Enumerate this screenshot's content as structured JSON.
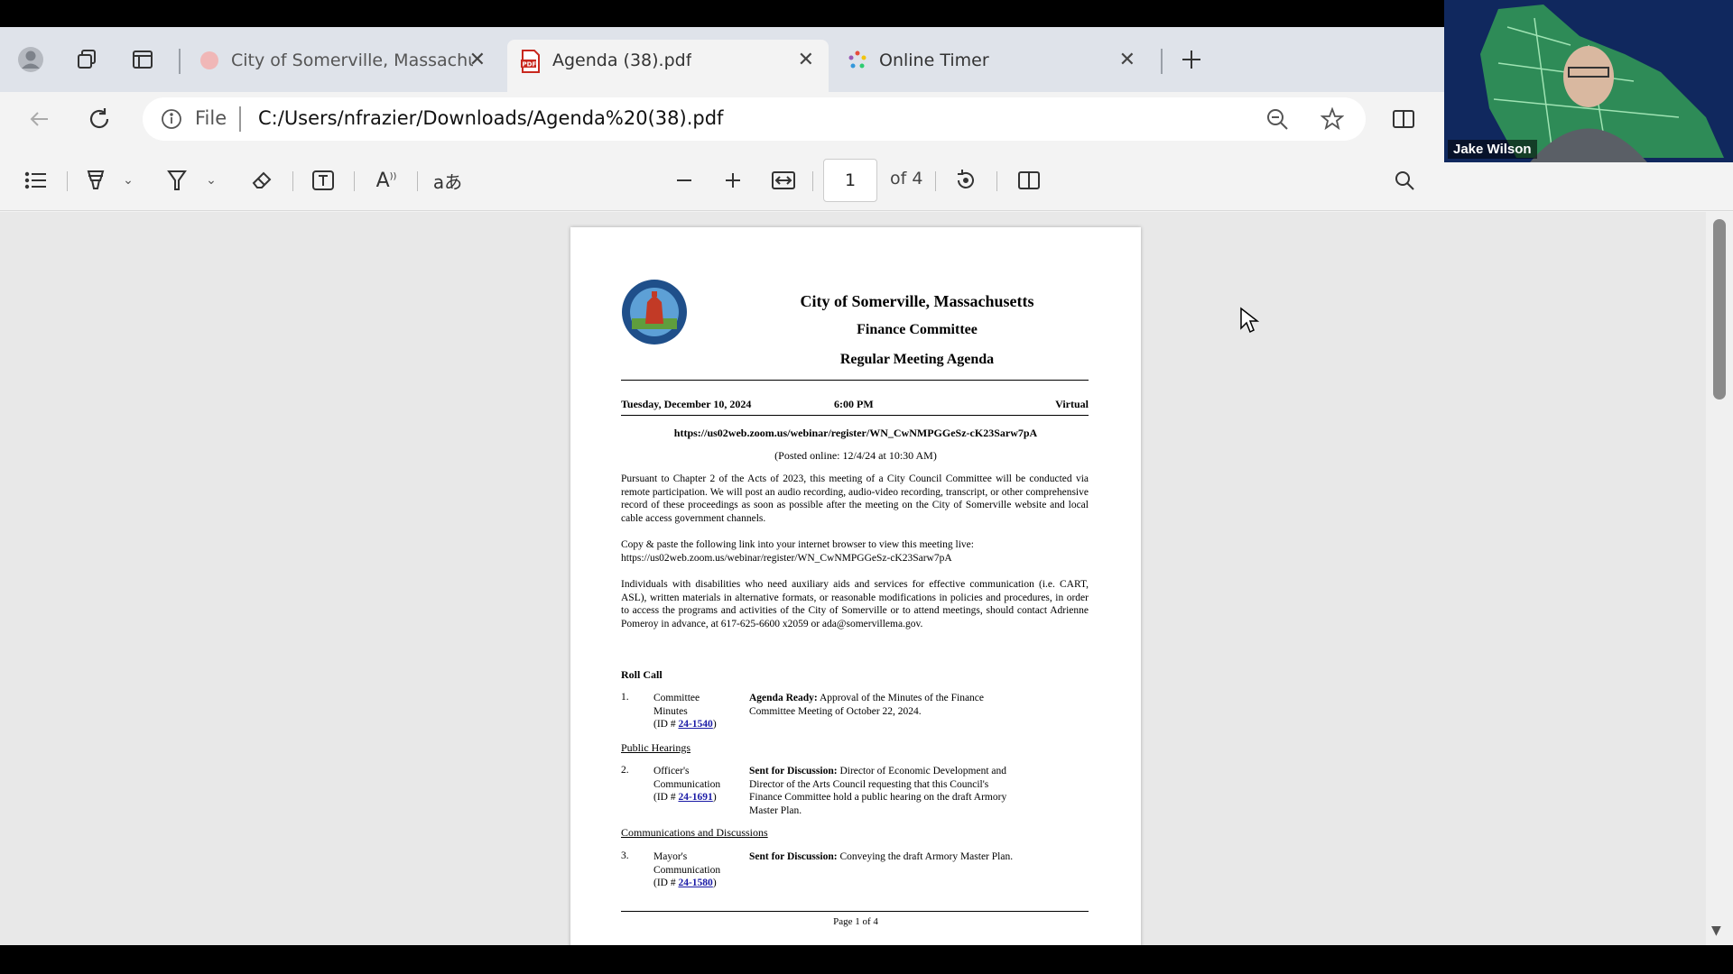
{
  "tabs": [
    {
      "title": "City of Somerville, Massachusetts",
      "active": false
    },
    {
      "title": "Agenda (38).pdf",
      "active": true
    },
    {
      "title": "Online Timer",
      "active": false
    }
  ],
  "address": {
    "scheme": "File",
    "url": "C:/Users/nfrazier/Downloads/Agenda%20(38).pdf"
  },
  "pdf_toolbar": {
    "page_current": "1",
    "page_total_label": "of 4"
  },
  "document": {
    "title": "City of Somerville, Massachusetts",
    "committee": "Finance Committee",
    "agenda_type": "Regular Meeting Agenda",
    "date": "Tuesday, December 10, 2024",
    "time": "6:00 PM",
    "location": "Virtual",
    "zoom_link": "https://us02web.zoom.us/webinar/register/WN_CwNMPGGeSz-cK23Sarw7pA",
    "posted": "(Posted online: 12/4/24 at 10:30 AM)",
    "para1": "Pursuant to Chapter 2 of the Acts of 2023, this meeting of a City Council Committee will be conducted via remote participation. We will post an audio recording, audio-video recording, transcript, or other comprehensive record of these proceedings as soon as possible after the meeting on the City of Somerville website and local cable access government channels.",
    "para2_intro": "Copy & paste the following link into your internet browser to view this meeting live:",
    "para2_link": "https://us02web.zoom.us/webinar/register/WN_CwNMPGGeSz-cK23Sarw7pA",
    "para3": "Individuals with disabilities who need auxiliary aids and services for effective communication (i.e. CART, ASL), written materials in alternative formats, or reasonable modifications in policies and procedures, in order to access the programs and activities of the City of Somerville or to attend meetings, should contact Adrienne Pomeroy in advance, at 617-625-6600 x2059 or ada@somervillema.gov.",
    "roll_call": "Roll Call",
    "section_public_hearings": "Public Hearings",
    "section_communications": "Communications and Discussions",
    "items": [
      {
        "num": "1.",
        "type_line1": "Committee",
        "type_line2": "Minutes",
        "id_prefix": "(ID # ",
        "id": "24-1540",
        "id_suffix": ")",
        "status": "Agenda Ready:",
        "text": "Approval of the Minutes of the Finance Committee Meeting of October 22, 2024."
      },
      {
        "num": "2.",
        "type_line1": "Officer's",
        "type_line2": "Communication",
        "id_prefix": "(ID # ",
        "id": "24-1691",
        "id_suffix": ")",
        "status": "Sent for Discussion:",
        "text": "Director of Economic Development and Director of the Arts Council requesting that this Council's Finance Committee hold a public hearing on the draft Armory Master Plan."
      },
      {
        "num": "3.",
        "type_line1": "Mayor's",
        "type_line2": "Communication",
        "id_prefix": "(ID # ",
        "id": "24-1580",
        "id_suffix": ")",
        "status": "Sent for Discussion:",
        "text": "Conveying the draft Armory Master Plan."
      }
    ],
    "footer": "Page 1 of 4"
  },
  "video": {
    "participant_name": "Jake Wilson"
  },
  "icons": [
    "profile-icon",
    "collections-icon",
    "tab-actions-icon",
    "back-icon",
    "refresh-icon",
    "info-icon",
    "zoom-out-icon",
    "favorite-icon",
    "split-screen-icon",
    "contents-icon",
    "highlight-icon",
    "draw-icon",
    "erase-icon",
    "text-icon",
    "read-aloud-icon",
    "translate-icon",
    "zoom-minus-icon",
    "zoom-plus-icon",
    "fit-width-icon",
    "rotate-icon",
    "page-view-icon",
    "search-icon"
  ]
}
